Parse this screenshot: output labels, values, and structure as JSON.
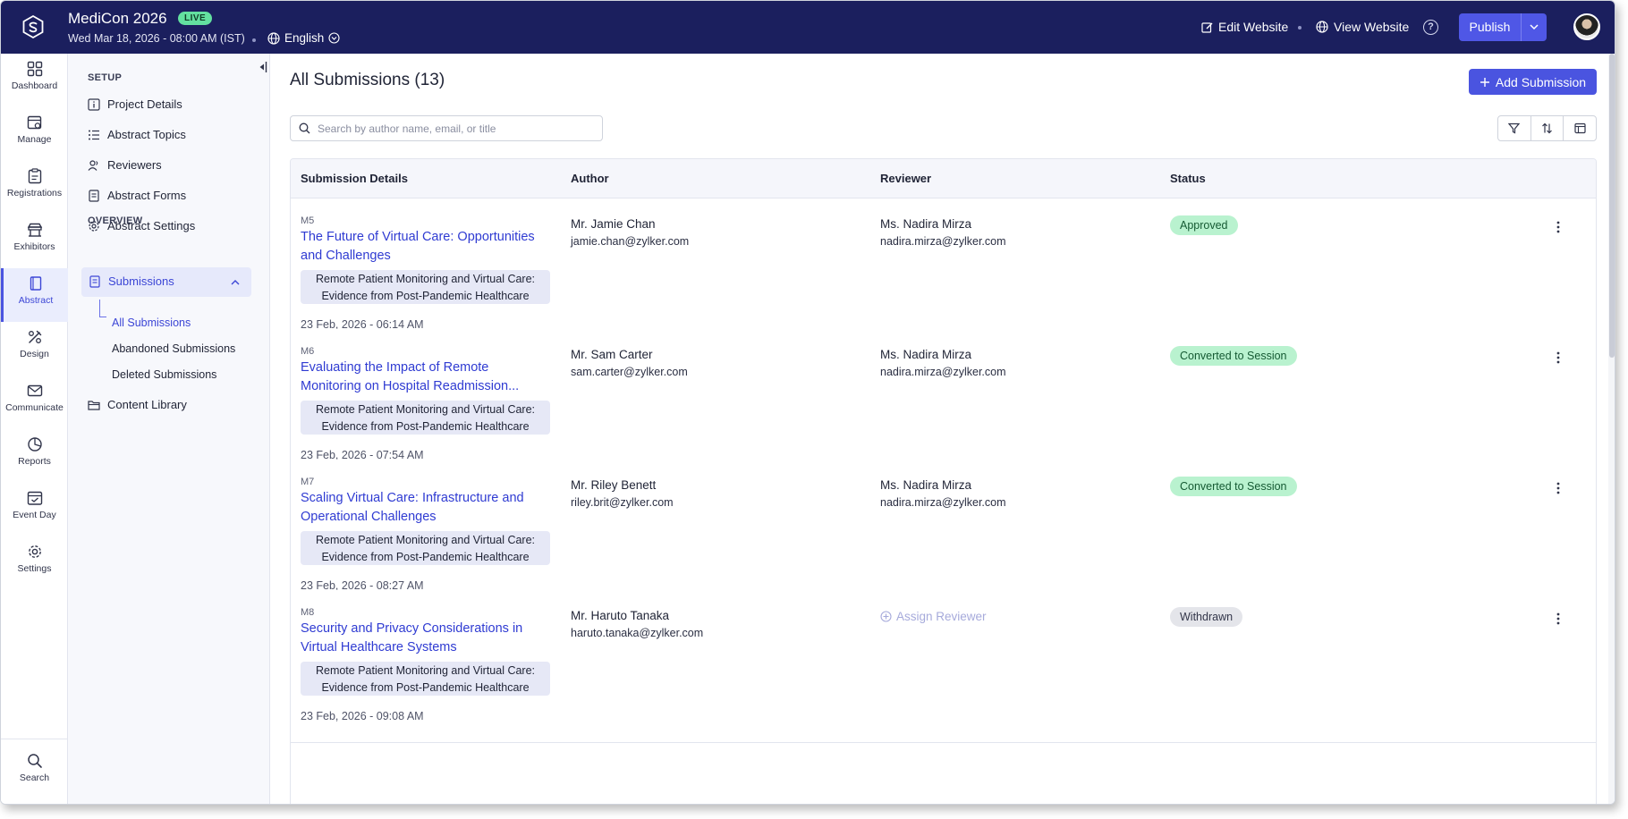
{
  "header": {
    "app_title": "MediCon 2026",
    "live_badge": "LIVE",
    "event_date": "Wed Mar 18, 2026 - 08:00 AM (IST)",
    "language": "English",
    "edit_website": "Edit Website",
    "view_website": "View Website",
    "help_icon": "?",
    "publish_label": "Publish",
    "accent_color": "#1b1f5e"
  },
  "rail": {
    "items": [
      {
        "label": "Dashboard",
        "icon": "grid-icon"
      },
      {
        "label": "Manage",
        "icon": "calendar-gear-icon"
      },
      {
        "label": "Registrations",
        "icon": "clipboard-icon"
      },
      {
        "label": "Exhibitors",
        "icon": "booth-icon"
      },
      {
        "label": "Abstract",
        "icon": "book-icon"
      },
      {
        "label": "Design",
        "icon": "design-icon"
      },
      {
        "label": "Communicate",
        "icon": "mail-icon"
      },
      {
        "label": "Reports",
        "icon": "pie-icon"
      },
      {
        "label": "Event Day",
        "icon": "calendar-check-icon"
      },
      {
        "label": "Settings",
        "icon": "gear-icon"
      }
    ],
    "search_label": "Search"
  },
  "subnav": {
    "setup_label": "SETUP",
    "setup_items": [
      {
        "label": "Project Details"
      },
      {
        "label": "Abstract Topics"
      },
      {
        "label": "Reviewers"
      },
      {
        "label": "Abstract Forms"
      },
      {
        "label": "Abstract Settings"
      }
    ],
    "overview_label": "OVERVIEW",
    "submissions_label": "Submissions",
    "sub_items": [
      {
        "label": "All Submissions"
      },
      {
        "label": "Abandoned Submissions"
      },
      {
        "label": "Deleted Submissions"
      }
    ],
    "content_library": "Content Library"
  },
  "main": {
    "page_title": "All Submissions (13)",
    "add_button": "Add Submission",
    "search_placeholder": "Search by author name, email, or title",
    "columns": [
      "Submission Details",
      "Author",
      "Reviewer",
      "Status"
    ],
    "rows": [
      {
        "id": "M5",
        "title": "The Future of Virtual Care: Opportunities and Challenges",
        "topic": "Remote Patient Monitoring and Virtual Care: Evidence from Post-Pandemic Healthcare",
        "date": "23 Feb, 2026 - 06:14 AM",
        "author_name": "Mr. Jamie Chan",
        "author_email": "jamie.chan@zylker.com",
        "reviewer_name": "Ms. Nadira Mirza",
        "reviewer_email": "nadira.mirza@zylker.com",
        "status": "Approved"
      },
      {
        "id": "M6",
        "title": "Evaluating the Impact of Remote Monitoring on Hospital Readmission...",
        "topic": "Remote Patient Monitoring and Virtual Care: Evidence from Post-Pandemic Healthcare",
        "date": "23 Feb, 2026 - 07:54 AM",
        "author_name": "Mr. Sam Carter",
        "author_email": "sam.carter@zylker.com",
        "reviewer_name": "Ms. Nadira Mirza",
        "reviewer_email": "nadira.mirza@zylker.com",
        "status": "Converted to Session"
      },
      {
        "id": "M7",
        "title": "Scaling Virtual Care: Infrastructure and Operational Challenges",
        "topic": "Remote Patient Monitoring and Virtual Care: Evidence from Post-Pandemic Healthcare",
        "date": "23 Feb, 2026 - 08:27 AM",
        "author_name": "Mr. Riley Benett",
        "author_email": "riley.brit@zylker.com",
        "reviewer_name": "Ms. Nadira Mirza",
        "reviewer_email": "nadira.mirza@zylker.com",
        "status": "Converted to Session"
      },
      {
        "id": "M8",
        "title": "Security and Privacy Considerations in Virtual Healthcare Systems",
        "topic": "Remote Patient Monitoring and Virtual Care: Evidence from Post-Pandemic Healthcare",
        "date": "23 Feb, 2026 - 09:08 AM",
        "author_name": "Mr. Haruto Tanaka",
        "author_email": "haruto.tanaka@zylker.com",
        "assign_reviewer": "Assign Reviewer",
        "status": "Withdrawn"
      }
    ]
  }
}
